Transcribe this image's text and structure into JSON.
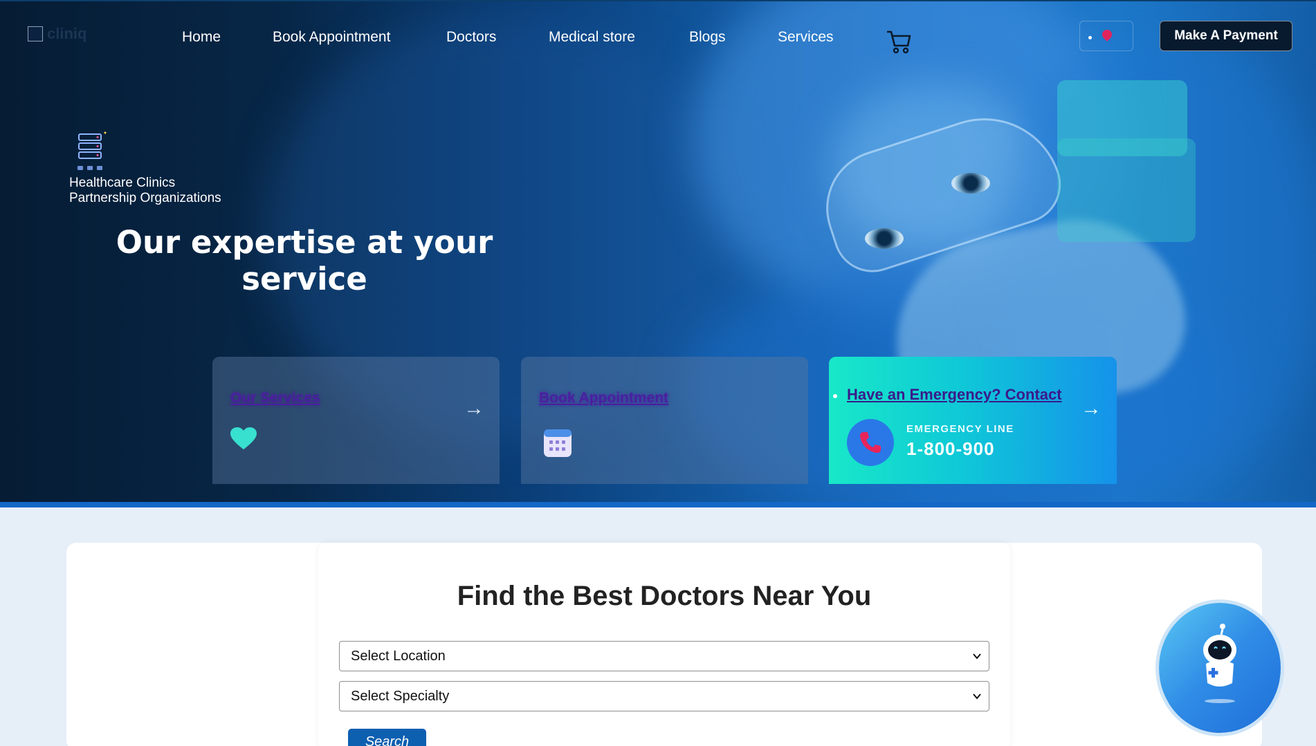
{
  "nav": {
    "logo_text": "cliniq",
    "links": [
      {
        "label": "Home"
      },
      {
        "label": "Book Appointment"
      },
      {
        "label": "Doctors"
      },
      {
        "label": "Medical store"
      },
      {
        "label": "Blogs"
      },
      {
        "label": "Services"
      }
    ],
    "payment_label": "Make A Payment"
  },
  "hero": {
    "partner_lines": [
      "Healthcare Clinics",
      "Partnership Organizations"
    ],
    "title": "Our expertise at your service"
  },
  "cards": {
    "services_label": "Our Services",
    "appointment_label": "Book Appointment",
    "emergency_link": "Have an Emergency? Contact",
    "emergency_line_label": "EMERGENCY LINE",
    "emergency_number": "1-800-900",
    "arrow": "→"
  },
  "search": {
    "title": "Find the Best Doctors Near You",
    "location_placeholder": "Select Location",
    "specialty_placeholder": "Select Specialty",
    "button_label": "Search"
  },
  "colors": {
    "hero_dark": "#061c34",
    "accent_blue": "#1367c7",
    "emergency_teal": "#18e8c8",
    "button_blue": "#0d5fb0"
  },
  "icons": [
    "heart-icon",
    "calendar-icon",
    "phone-icon",
    "cart-icon",
    "location-pin-icon",
    "server-icon",
    "chatbot-icon",
    "arrow-right-icon"
  ]
}
